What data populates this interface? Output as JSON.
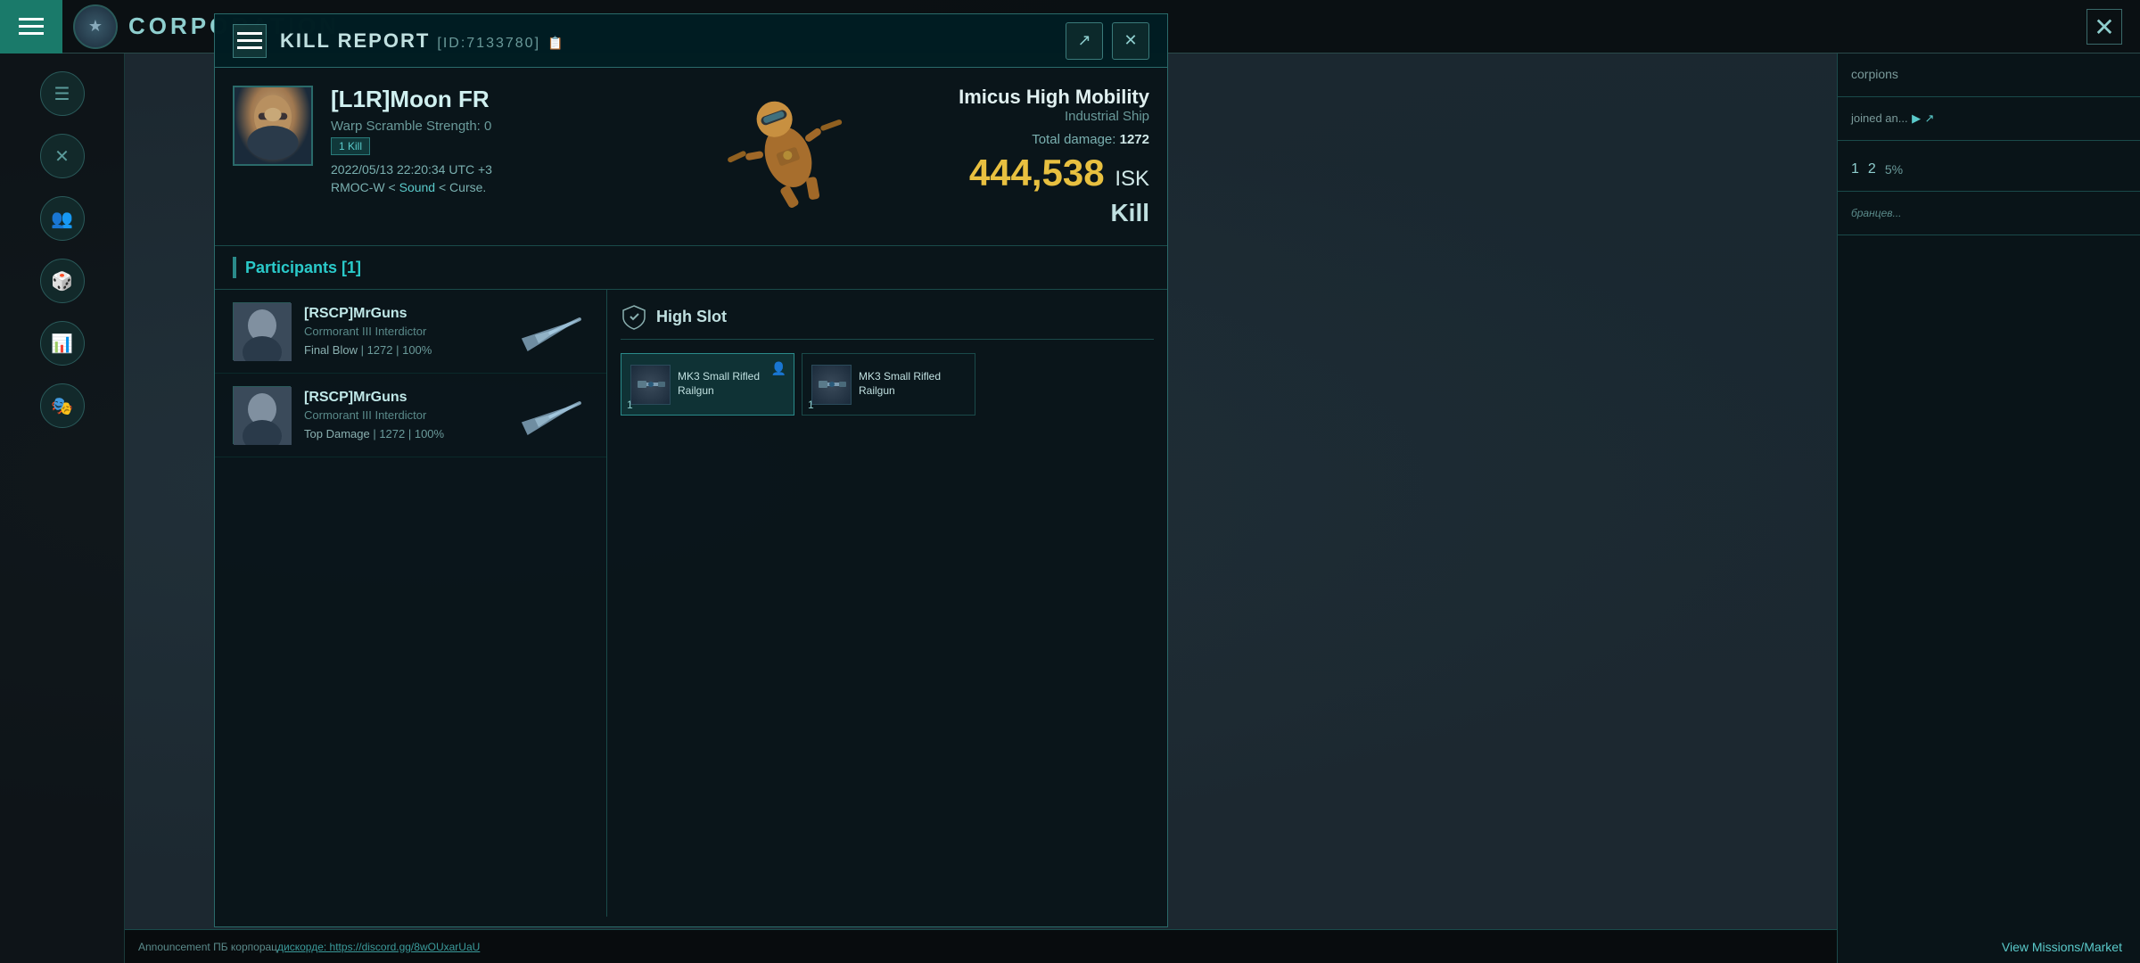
{
  "topbar": {
    "title": "CORPORATION",
    "close_label": "✕"
  },
  "sidebar": {
    "icons": [
      "☰",
      "✕",
      "👥",
      "🎲",
      "📊",
      "🎭"
    ]
  },
  "kill_report": {
    "title": "KILL REPORT",
    "id": "[ID:7133780]",
    "clipboard_icon": "📋",
    "victim": {
      "name": "[L1R]Moon FR",
      "warp_scramble": "Warp Scramble Strength: 0",
      "kills_badge": "1 Kill",
      "timestamp": "2022/05/13 22:20:34 UTC +3",
      "location": "RMOC-W < Sound < Curse.",
      "location_highlight": "Sound"
    },
    "ship": {
      "name": "Imicus High Mobility",
      "type": "Industrial Ship",
      "total_damage_label": "Total damage:",
      "total_damage_value": "1272",
      "isk_value": "444,538",
      "isk_unit": "ISK",
      "outcome": "Kill"
    },
    "participants_label": "Participants [1]",
    "participants": [
      {
        "name": "[RSCP]MrGuns",
        "ship": "Cormorant III Interdictor",
        "stat_type": "Final Blow",
        "damage": "1272",
        "percent": "100%"
      },
      {
        "name": "[RSCP]MrGuns",
        "ship": "Cormorant III Interdictor",
        "stat_type": "Top Damage",
        "damage": "1272",
        "percent": "100%"
      }
    ],
    "slots": {
      "section_title": "High Slot",
      "items": [
        {
          "name": "MK3 Small Rifled Railgun",
          "count": "1",
          "highlighted": true
        },
        {
          "name": "MK3 Small Rifled Railgun",
          "count": "1",
          "highlighted": false
        }
      ]
    }
  },
  "right_panel": {
    "scorpions_text": "corpions",
    "joined_text": "joined an...",
    "numbers": [
      "1",
      "2"
    ],
    "percent": "5%",
    "samples_text": "бранцев...",
    "view_missions": "View Missions/Market"
  },
  "announcement": {
    "title": "Announcement",
    "text": "ПБ корпорац",
    "discord_label": "дискорде: https://discord.gg/8wOUxarUaU"
  }
}
